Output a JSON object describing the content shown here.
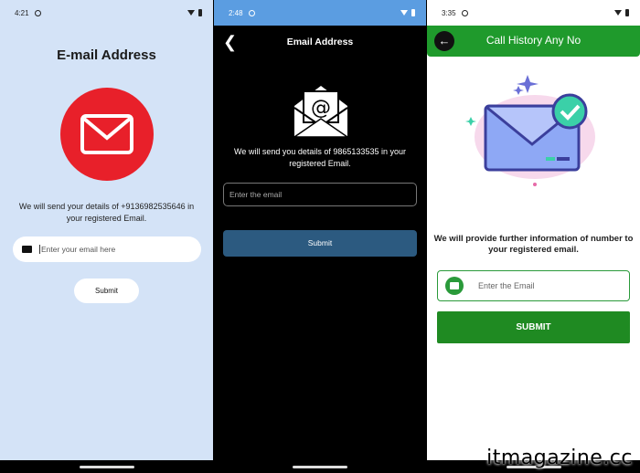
{
  "screen1": {
    "status_time": "4:21",
    "title": "E-mail Address",
    "description": "We will send your details of +9136982535646 in your registered Email.",
    "email_placeholder": "Enter your email here",
    "submit_label": "Submit",
    "icon_circle_color": "#e8202a"
  },
  "screen2": {
    "status_time": "2:48",
    "header_title": "Email Address",
    "description": "We will send you details of 9865133535 in your registered Email.",
    "email_placeholder": "Enter the email",
    "submit_label": "Submit",
    "status_color": "#5b9de1",
    "button_color": "#2c5a80"
  },
  "screen3": {
    "status_time": "3:35",
    "header_title": "Call History Any No",
    "description": "We will provide further information of number to your registered email.",
    "email_placeholder": "Enter the Email",
    "submit_label": "SUBMIT",
    "accent_color": "#1f9a2c"
  },
  "watermark": "itmagazine.cc"
}
